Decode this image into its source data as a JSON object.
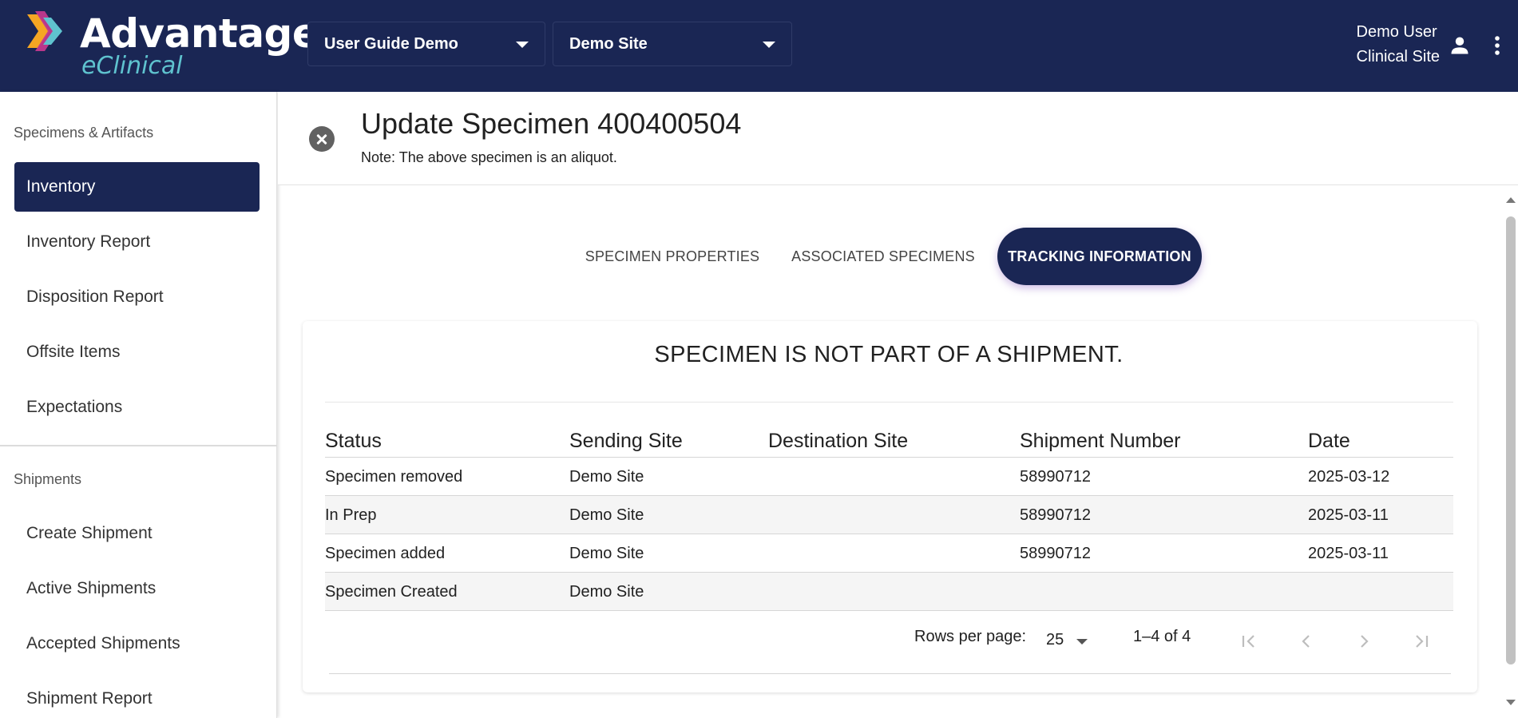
{
  "header": {
    "logo": {
      "title": "Advantage",
      "subtitle": "eClinical"
    },
    "study_selector": {
      "value": "User Guide Demo"
    },
    "site_selector": {
      "value": "Demo Site"
    },
    "user": {
      "name": "Demo User",
      "role": "Clinical Site"
    },
    "colors": {
      "bar": "#1a2654",
      "subtitle": "#5fc3cf"
    }
  },
  "sidebar": {
    "sections": [
      {
        "title": "Specimens & Artifacts",
        "items": [
          "Inventory",
          "Inventory Report",
          "Disposition Report",
          "Offsite Items",
          "Expectations"
        ]
      },
      {
        "title": "Shipments",
        "items": [
          "Create Shipment",
          "Active Shipments",
          "Accepted Shipments",
          "Shipment Report"
        ]
      }
    ],
    "active_item": "Inventory"
  },
  "page": {
    "title": "Update Specimen 400400504",
    "note": "Note: The above specimen is an aliquot."
  },
  "tabs": {
    "items": [
      "SPECIMEN PROPERTIES",
      "ASSOCIATED SPECIMENS",
      "TRACKING INFORMATION"
    ],
    "active": "TRACKING INFORMATION"
  },
  "tracking": {
    "message": "SPECIMEN IS NOT PART OF A SHIPMENT.",
    "columns": [
      "Status",
      "Sending Site",
      "Destination Site",
      "Shipment Number",
      "Date"
    ],
    "rows": [
      [
        "Specimen removed",
        "Demo Site",
        "",
        "58990712",
        "2025-03-12"
      ],
      [
        "In Prep",
        "Demo Site",
        "",
        "58990712",
        "2025-03-11"
      ],
      [
        "Specimen added",
        "Demo Site",
        "",
        "58990712",
        "2025-03-11"
      ],
      [
        "Specimen Created",
        "Demo Site",
        "",
        "",
        ""
      ]
    ],
    "pagination": {
      "rows_per_page_label": "Rows per page:",
      "rows_per_page": "25",
      "range": "1–4 of 4"
    }
  }
}
